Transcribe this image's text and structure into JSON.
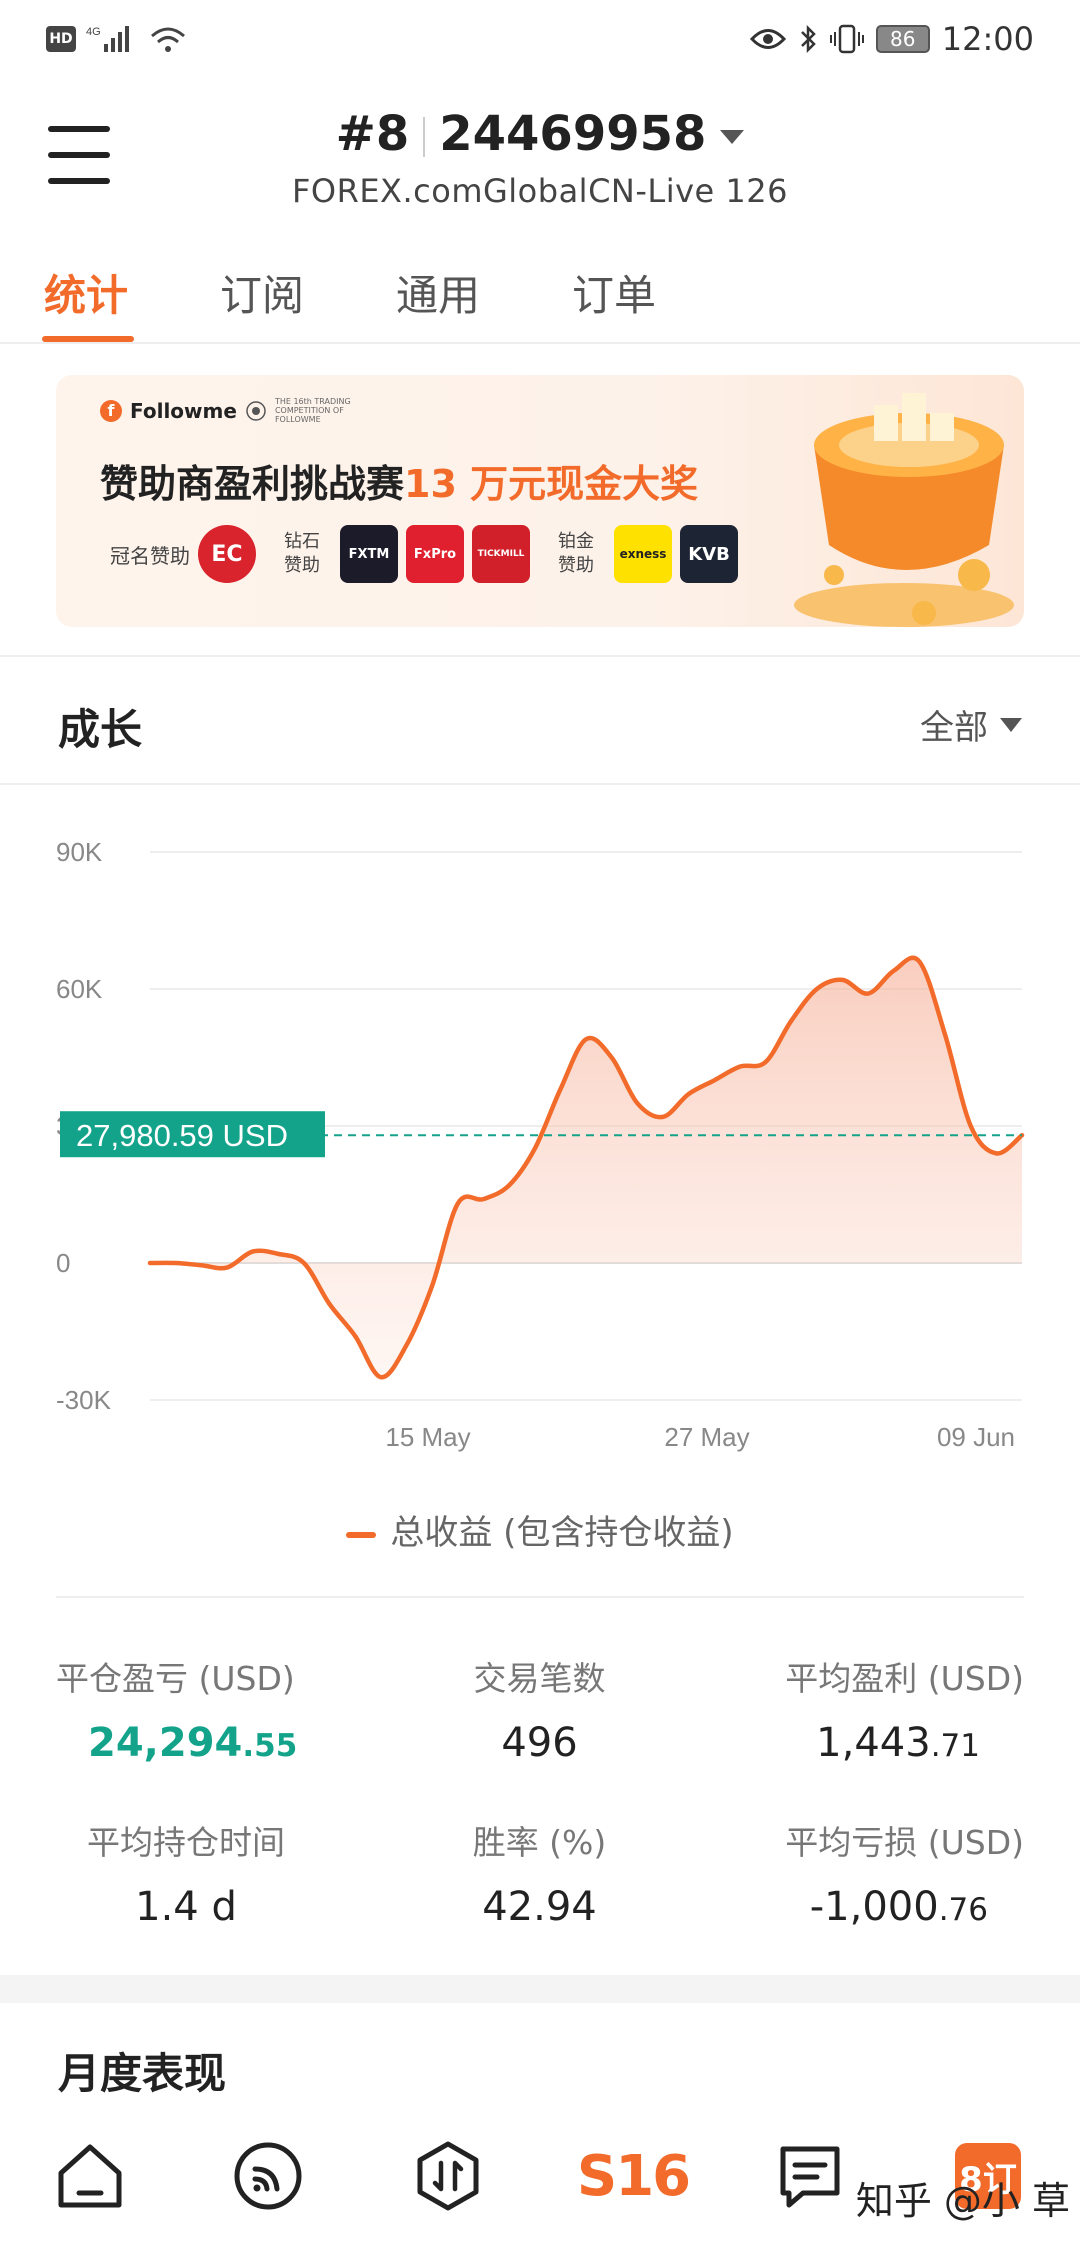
{
  "status_bar": {
    "network": "4G",
    "battery": "86",
    "time": "12:00"
  },
  "header": {
    "account_index": "#8",
    "account_number": "24469958",
    "server": "FOREX.comGlobalCN-Live 126"
  },
  "tabs": [
    {
      "label": "统计",
      "active": true
    },
    {
      "label": "订阅",
      "active": false
    },
    {
      "label": "通用",
      "active": false
    },
    {
      "label": "订单",
      "active": false
    }
  ],
  "banner": {
    "brand": "Followme",
    "competition_note": "THE 16th TRADING COMPETITION OF FOLLOWME",
    "title_prefix": "赞助商盈利挑战赛",
    "title_highlight": "13 万元现金大奖",
    "title_sponsor_label": "冠名赞助",
    "diamond_label": "钻石赞助",
    "platinum_label": "铂金赞助",
    "sponsors": [
      "EC",
      "FXTM",
      "FxPro",
      "TICKMILL",
      "exness",
      "KVB"
    ]
  },
  "growth": {
    "title": "成长",
    "filter": "全部",
    "current_value_label": "27,980.59 USD",
    "legend": "总收益 (包含持仓收益)"
  },
  "chart_data": {
    "type": "area",
    "series": [
      {
        "name": "总收益 (包含持仓收益)",
        "color": "#f26b2a",
        "values": [
          0,
          0,
          -500,
          -1000,
          2500,
          2000,
          0,
          -9000,
          -16000,
          -25000,
          -18000,
          -5000,
          13000,
          14000,
          17000,
          25000,
          38000,
          49000,
          45000,
          35000,
          32000,
          37000,
          40000,
          43000,
          44000,
          53000,
          60000,
          62000,
          59000,
          64000,
          66000,
          50000,
          30000,
          24000,
          27980.59
        ]
      }
    ],
    "x_tick_labels": [
      "15 May",
      "27 May",
      "09 Jun"
    ],
    "y_tick_labels": [
      "90K",
      "60K",
      "30K",
      "0",
      "-30K"
    ],
    "ylim": [
      -30000,
      90000
    ],
    "reference_value": 27980.59,
    "reference_color": "#13a38a"
  },
  "stats": [
    {
      "label": "平仓盈亏 (USD)",
      "value_main": "24,294",
      "value_dec": ".55",
      "highlight": true
    },
    {
      "label": "交易笔数",
      "value_main": "496",
      "value_dec": "",
      "highlight": false
    },
    {
      "label": "平均盈利 (USD)",
      "value_main": "1,443",
      "value_dec": ".71",
      "highlight": false
    },
    {
      "label": "平均持仓时间",
      "value_main": "1.4 d",
      "value_dec": "",
      "highlight": false
    },
    {
      "label": "胜率 (%)",
      "value_main": "42.94",
      "value_dec": "",
      "highlight": false
    },
    {
      "label": "平均亏损 (USD)",
      "value_main": "-1,000",
      "value_dec": ".76",
      "highlight": false
    }
  ],
  "monthly": {
    "title": "月度表现"
  },
  "bottom_nav": {
    "s16_label": "S16",
    "badge_label": "8订"
  },
  "watermark": "知乎 @小 草"
}
